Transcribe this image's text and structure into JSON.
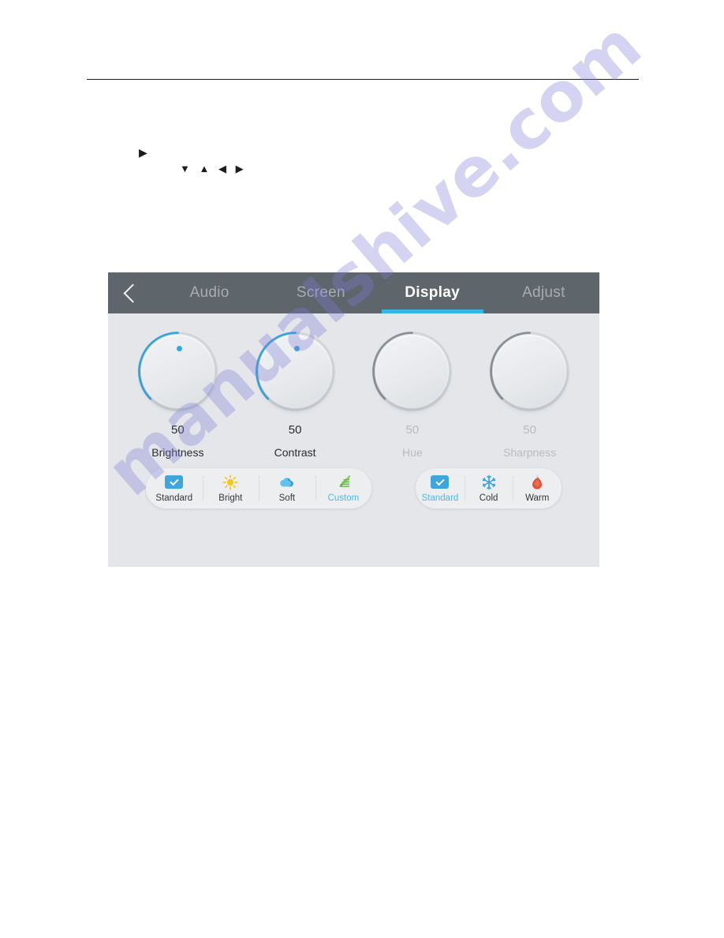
{
  "document": {
    "bullet_glyph": "▶",
    "nav_glyphs": [
      "▼",
      "▲",
      "◀",
      "▶"
    ],
    "watermark": "manualshive.com"
  },
  "osd": {
    "back_icon": "back-chevron-icon",
    "tabs": [
      {
        "label": "Audio",
        "active": false
      },
      {
        "label": "Screen",
        "active": false
      },
      {
        "label": "Display",
        "active": true
      },
      {
        "label": "Adjust",
        "active": false
      }
    ],
    "knobs": [
      {
        "label": "Brightness",
        "value": "50",
        "enabled": true
      },
      {
        "label": "Contrast",
        "value": "50",
        "enabled": true
      },
      {
        "label": "Hue",
        "value": "50",
        "enabled": false
      },
      {
        "label": "Sharpness",
        "value": "50",
        "enabled": false
      }
    ],
    "picture_modes": [
      {
        "label": "Standard",
        "icon": "checkbox-icon",
        "selected": false
      },
      {
        "label": "Bright",
        "icon": "sun-icon",
        "selected": false
      },
      {
        "label": "Soft",
        "icon": "cloud-icon",
        "selected": false
      },
      {
        "label": "Custom",
        "icon": "pencil-icon",
        "selected": true
      }
    ],
    "color_temps": [
      {
        "label": "Standard",
        "icon": "checkbox-icon",
        "selected": true
      },
      {
        "label": "Cold",
        "icon": "snowflake-icon",
        "selected": false
      },
      {
        "label": "Warm",
        "icon": "flame-icon",
        "selected": false
      }
    ],
    "colors": {
      "accent": "#37b6e4",
      "header_bg": "#5e666c",
      "panel_bg": "#e4e6e9",
      "knob_arc_active": "#37a6dd",
      "knob_arc_disabled": "#8d9298",
      "sun": "#f5c518",
      "cloud": "#4fb8e8",
      "pencil": "#62bb46",
      "snowflake": "#3ea5dd",
      "flame": "#e2533d"
    }
  }
}
